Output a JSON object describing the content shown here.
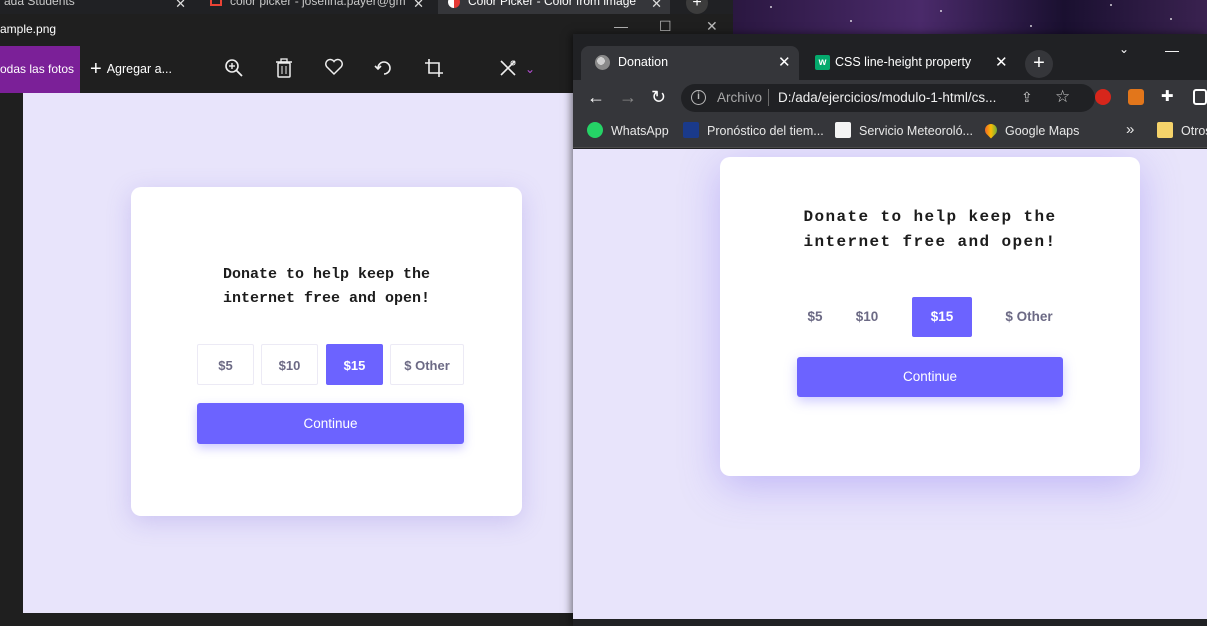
{
  "background_tabs": [
    {
      "title": "ada Students"
    },
    {
      "title": "color picker - josefina.payer@gm"
    },
    {
      "title": "Color Picker - Color from image"
    }
  ],
  "photos_app": {
    "file_name": "ample.png",
    "all_photos_label": "odas las fotos",
    "add_to_label": "Agregar a...",
    "icons": [
      "zoom-in-icon",
      "trash-icon",
      "heart-icon",
      "rotate-icon",
      "crop-icon",
      "edit-icon",
      "chevron-down-icon"
    ]
  },
  "donation_card": {
    "headline_line1": "Donate to help keep the",
    "headline_line2": "internet free and open!",
    "amounts": [
      "$5",
      "$10",
      "$15",
      "$ Other"
    ],
    "selected_amount": "$15",
    "continue_label": "Continue"
  },
  "chrome": {
    "tabs": [
      {
        "title": "Donation",
        "active": true
      },
      {
        "title": "CSS line-height property",
        "active": false
      }
    ],
    "omnibox": {
      "scheme_label": "Archivo",
      "url": "D:/ada/ejercicios/modulo-1-html/cs..."
    },
    "bookmarks": [
      {
        "label": "WhatsApp"
      },
      {
        "label": "Pronóstico del tiem..."
      },
      {
        "label": "Servicio Meteoroló..."
      },
      {
        "label": "Google Maps"
      }
    ],
    "more_bookmarks_label": "»",
    "other_bookmarks_label": "Otros"
  },
  "colors": {
    "accent": "#6c63ff",
    "page_background": "#e8e4fb",
    "photos_accent": "#7b2098",
    "chrome_dark": "#202124"
  }
}
